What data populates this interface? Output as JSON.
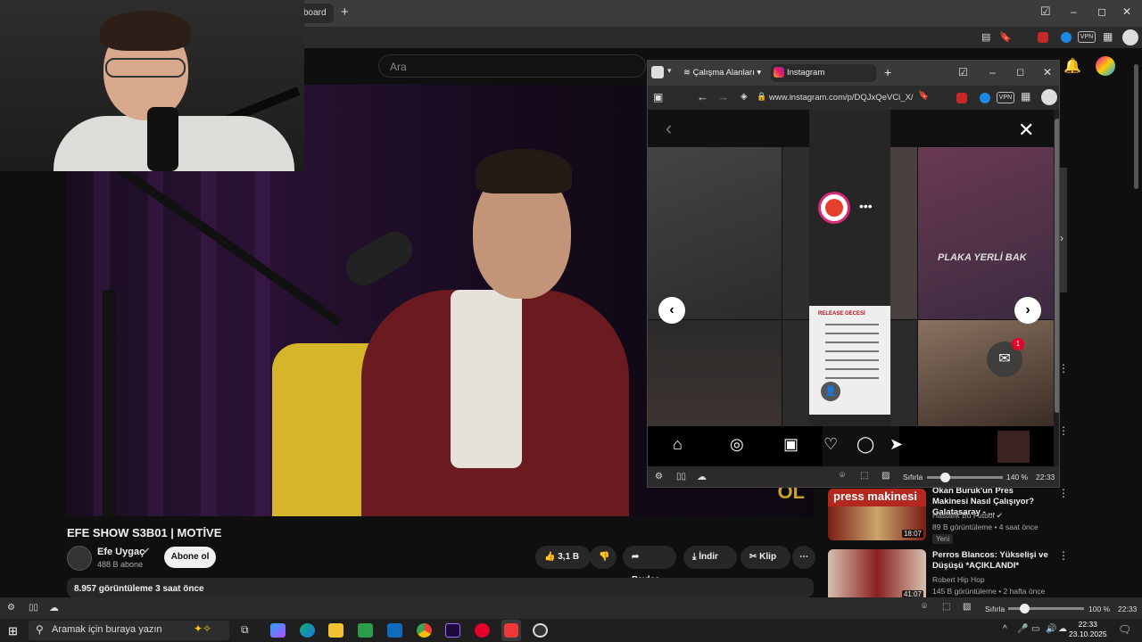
{
  "browser": {
    "active_tab_label": "board",
    "new_tab_symbol": "+",
    "window_controls": [
      "–",
      "◻",
      "✕"
    ]
  },
  "youtube": {
    "search_placeholder": "Ara",
    "video": {
      "title": "EFE SHOW S3B01 | MOTİVE",
      "overlay_logo": "OL",
      "channel_name": "Efe Uygaç",
      "channel_verified": "✔",
      "subscribers": "488 B abone",
      "subscribe_label": "Abone ol",
      "likes": "3,1 B",
      "share_label": "Paylaş",
      "download_label": "İndir",
      "clip_label": "Klip",
      "more_label": "⋯",
      "description_stats": "8.957 görüntüleme  3 saat önce"
    },
    "recommendations": [
      {
        "title": "Okan Buruk'un Pres Makinesi Nasıl Çalışıyor? Galatasaray - ...",
        "channel": "Hastalık Bu Futbol ✔",
        "meta": "89 B görüntüleme • 4 saat önce",
        "badge": "Yeni",
        "duration": "18:07",
        "thumb_text": "press makinesi",
        "thumb_color": "#b3281f"
      },
      {
        "title": "Perros Blancos: Yükselişi ve Düşüşü *AÇIKLANDI*",
        "channel": "Robert Hip Hop",
        "meta": "145 B görüntüleme • 2 hafta önce",
        "duration": "41:07",
        "thumb_color": "#7a1a1a"
      }
    ]
  },
  "popup": {
    "workspaces_label": "Çalışma Alanları",
    "tab_title": "Instagram",
    "url": "www.instagram.com/p/DQJxQeVCi_X/",
    "instagram": {
      "grid_text": "PLAKA YERLİ BAK",
      "release_title": "RELEASE GECESİ",
      "more_dots": "•••",
      "unread_messages": "1"
    },
    "status": {
      "reset_label": "Sıfırla",
      "zoom": "140 %",
      "time": "22:33"
    }
  },
  "vivaldi_status": {
    "reset_label": "Sıfırla",
    "zoom": "100 %",
    "time": "22:33"
  },
  "taskbar": {
    "search_placeholder": "Aramak için buraya yazın",
    "clock_time": "22:33",
    "clock_date": "23.10.2025"
  },
  "colors": {
    "youtube_bg": "#0f0f0f",
    "instagram_gradient": "#d62976",
    "accent_red": "#e4002b"
  }
}
